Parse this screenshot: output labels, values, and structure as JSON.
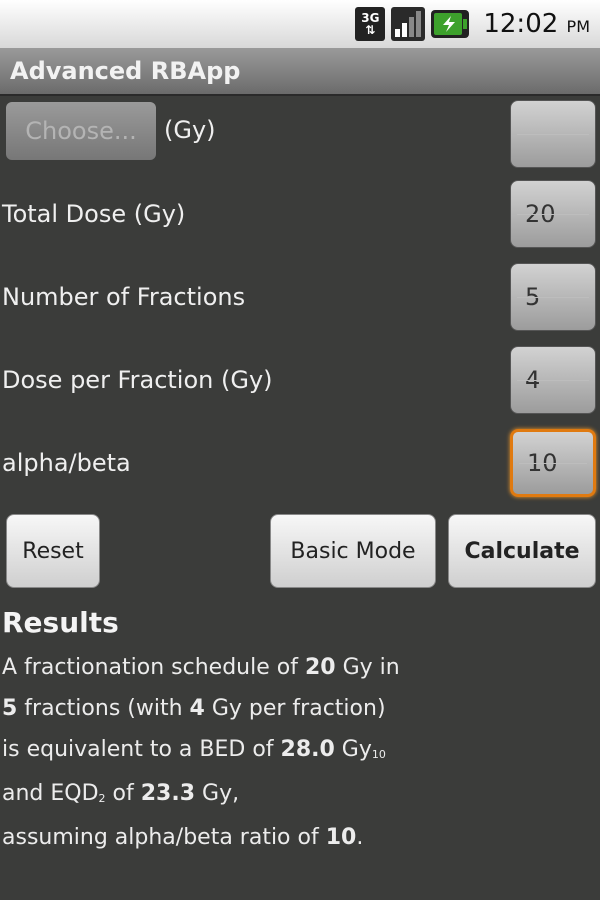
{
  "status_bar": {
    "network": "3G",
    "time": "12:02",
    "ampm": "PM"
  },
  "title_bar": {
    "title": "Advanced RBApp"
  },
  "form": {
    "choose_placeholder": "Choose...",
    "choose_unit": "(Gy)",
    "choose_value": "",
    "total_dose_label": "Total Dose (Gy)",
    "total_dose_value": "20",
    "fractions_label": "Number of Fractions",
    "fractions_value": "5",
    "dose_per_fraction_label": "Dose per Fraction (Gy)",
    "dose_per_fraction_value": "4",
    "alpha_beta_label": "alpha/beta",
    "alpha_beta_value": "10"
  },
  "buttons": {
    "reset": "Reset",
    "basic_mode": "Basic Mode",
    "calculate": "Calculate"
  },
  "results": {
    "heading": "Results",
    "line1_prefix": "A fractionation schedule of ",
    "line1_dose": "20",
    "line1_suffix": " Gy in",
    "line2_fractions": "5",
    "line2_middle": " fractions (with ",
    "line2_dpf": "4",
    "line2_suffix": " Gy per fraction)",
    "line3_prefix": "is equivalent to a BED of ",
    "line3_bed": "28.0",
    "line3_unit": " Gy",
    "line3_sub": "10",
    "line4_prefix": "and EQD",
    "line4_sub": "2",
    "line4_middle": " of ",
    "line4_eqd": "23.3",
    "line4_suffix": " Gy,",
    "line5_prefix": "assuming alpha/beta ratio of ",
    "line5_ab": "10",
    "line5_suffix": "."
  }
}
